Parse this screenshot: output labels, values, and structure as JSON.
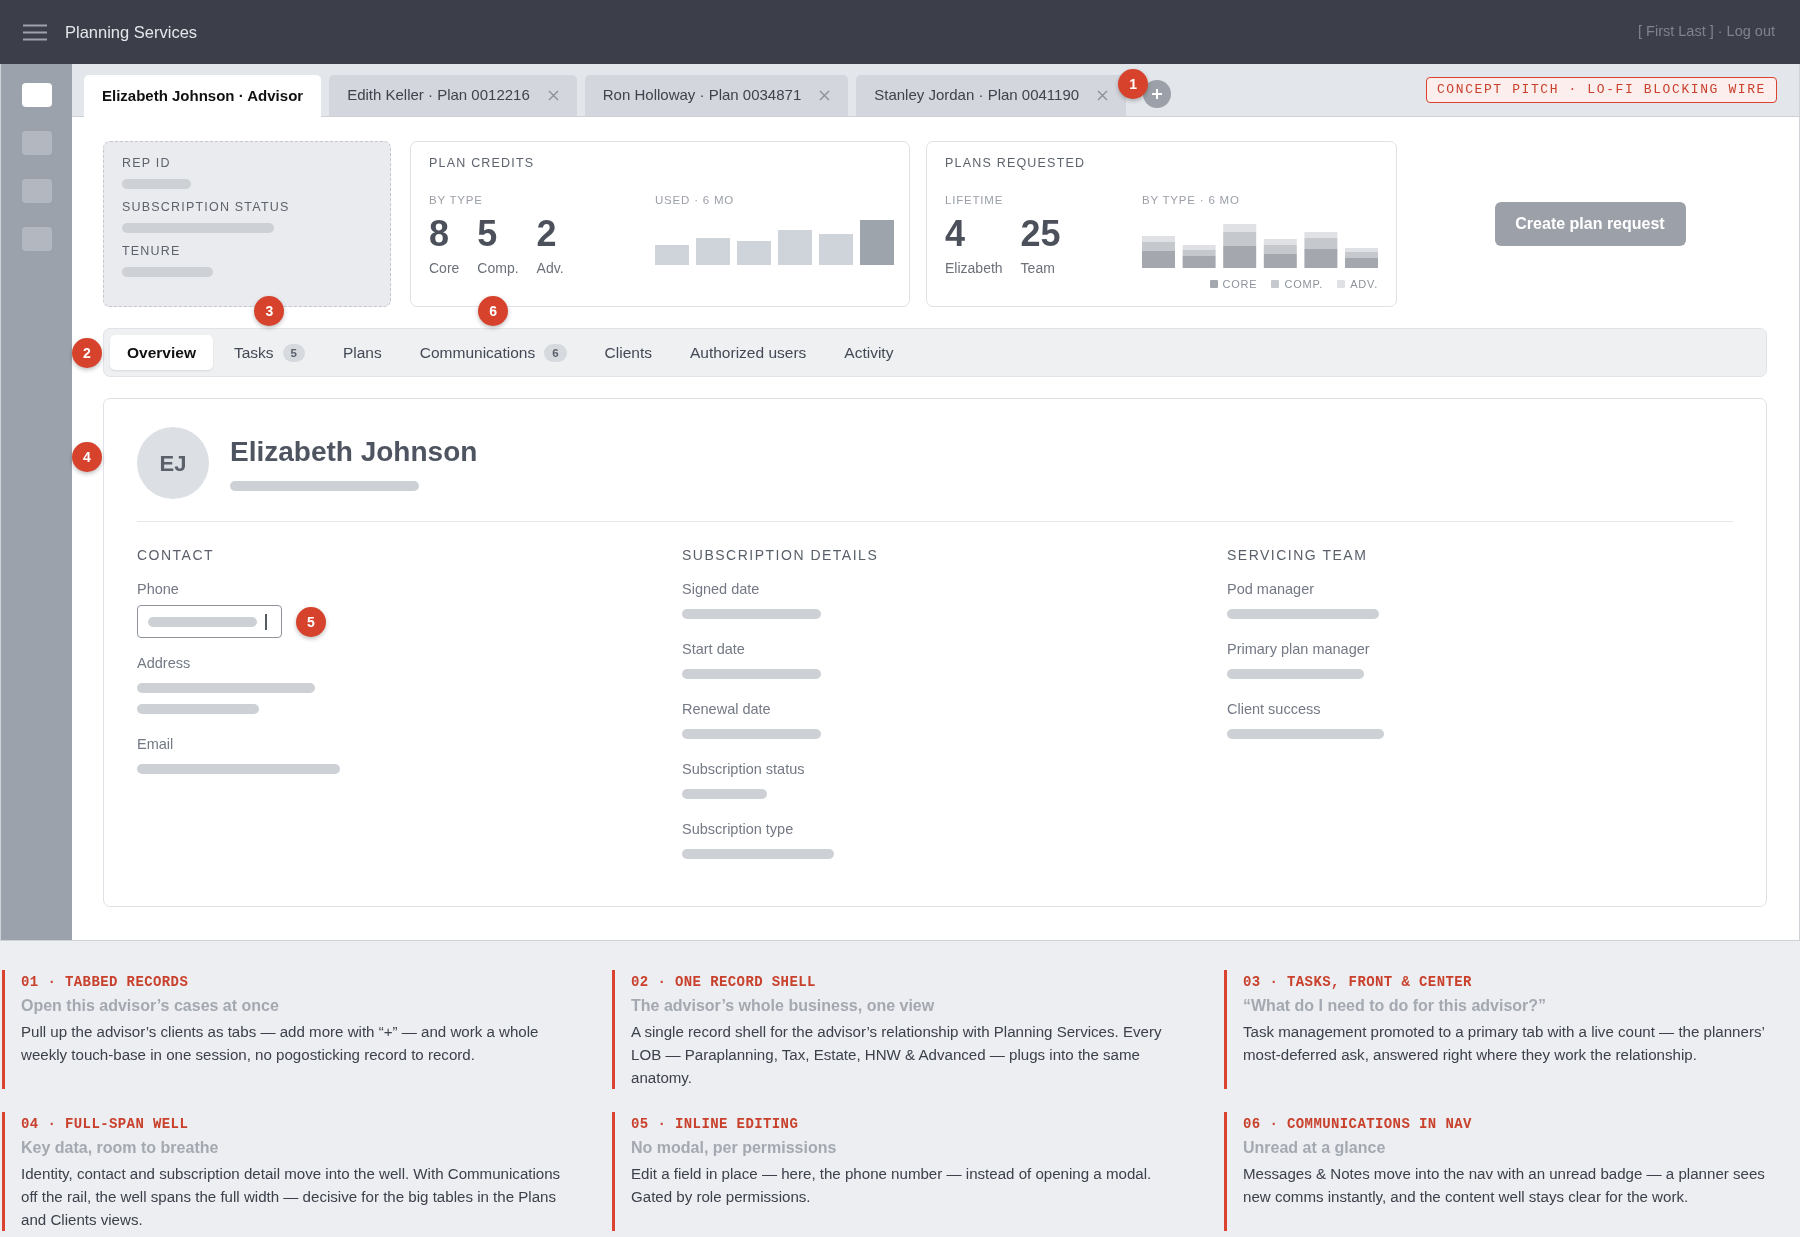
{
  "top_bar": {
    "title": "Planning Services",
    "user": "[ First Last ]",
    "separator": "·",
    "logout": "Log out"
  },
  "rail": {
    "items": [
      {
        "selected": true
      },
      {
        "selected": false
      },
      {
        "selected": false
      },
      {
        "selected": false
      }
    ]
  },
  "record_tabs": {
    "callout": "1",
    "tabs": [
      {
        "label": "Elizabeth Johnson · Advisor",
        "selected": true,
        "closable": false
      },
      {
        "label": "Edith Keller · Plan 0012216",
        "selected": false,
        "closable": true
      },
      {
        "label": "Ron Holloway · Plan 0034871",
        "selected": false,
        "closable": true
      },
      {
        "label": "Stanley Jordan · Plan 0041190",
        "selected": false,
        "closable": true
      }
    ]
  },
  "stamp": "CONCEPT PITCH · LO-FI BLOCKING WIRE",
  "summary": {
    "fields": [
      {
        "label": "REP ID"
      },
      {
        "label": "SUBSCRIPTION STATUS"
      },
      {
        "label": "TENURE"
      }
    ]
  },
  "plan_credits": {
    "title": "PLAN CREDITS",
    "stats_label": "BY TYPE",
    "stats": [
      {
        "value": "8",
        "label": "Core"
      },
      {
        "value": "5",
        "label": "Comp."
      },
      {
        "value": "2",
        "label": "Adv."
      }
    ],
    "chart_label": "USED · 6 MO"
  },
  "plans_requested": {
    "title": "PLANS REQUESTED",
    "stats_label": "LIFETIME",
    "stats": [
      {
        "value": "4",
        "label": "Elizabeth"
      },
      {
        "value": "25",
        "label": "Team"
      }
    ],
    "chart_label": "BY TYPE · 6 MO",
    "legend": [
      {
        "label": "CORE",
        "color": "#a4a8ae"
      },
      {
        "label": "COMP.",
        "color": "#c5c8cd"
      },
      {
        "label": "ADV.",
        "color": "#dfe1e5"
      }
    ]
  },
  "create_button": "Create plan request",
  "section_nav": {
    "callout": "2",
    "items": [
      {
        "label": "Overview",
        "selected": true
      },
      {
        "label": "Tasks",
        "count": "5",
        "callout": "3",
        "selected": false
      },
      {
        "label": "Plans",
        "selected": false
      },
      {
        "label": "Communications",
        "count": "6",
        "callout": "6",
        "selected": false
      },
      {
        "label": "Clients",
        "selected": false
      },
      {
        "label": "Authorized users",
        "selected": false
      },
      {
        "label": "Activity",
        "selected": false
      }
    ]
  },
  "well": {
    "callout": "4",
    "initials": "EJ",
    "name": "Elizabeth Johnson",
    "columns": [
      {
        "heading": "CONTACT",
        "fields": [
          {
            "label": "Phone",
            "kind": "input",
            "callout": "5"
          },
          {
            "label": "Address",
            "kind": "multiline"
          },
          {
            "label": "Email",
            "kind": "line"
          }
        ]
      },
      {
        "heading": "SUBSCRIPTION DETAILS",
        "fields": [
          {
            "label": "Signed date",
            "kind": "line"
          },
          {
            "label": "Start date",
            "kind": "line"
          },
          {
            "label": "Renewal date",
            "kind": "line"
          },
          {
            "label": "Subscription status",
            "kind": "line"
          },
          {
            "label": "Subscription type",
            "kind": "line"
          }
        ]
      },
      {
        "heading": "SERVICING TEAM",
        "fields": [
          {
            "label": "Pod manager",
            "kind": "line"
          },
          {
            "label": "Primary plan manager",
            "kind": "line"
          },
          {
            "label": "Client success",
            "kind": "line"
          }
        ]
      }
    ]
  },
  "notes": [
    {
      "title": "01 · TABBED RECORDS",
      "subtitle": "Open this advisor’s cases at once",
      "body": "Pull up the advisor’s clients as tabs — add more with “+” — and work a whole weekly touch-base in one session, no pogosticking record to record."
    },
    {
      "title": "02 · ONE RECORD SHELL",
      "subtitle": "The advisor’s whole business, one view",
      "body": "A single record shell for the advisor’s relationship with Planning Services. Every LOB — Paraplanning, Tax, Estate, HNW & Advanced — plugs into the same anatomy."
    },
    {
      "title": "03 · TASKS, FRONT & CENTER",
      "subtitle": "“What do I need to do for this advisor?”",
      "body": "Task management promoted to a primary tab with a live count — the planners’ most-deferred ask, answered right where they work the relationship."
    },
    {
      "title": "04 · FULL-SPAN WELL",
      "subtitle": "Key data, room to breathe",
      "body": "Identity, contact and subscription detail move into the well. With Communications off the rail, the well spans the full width — decisive for the big tables in the Plans and Clients views."
    },
    {
      "title": "05 · INLINE EDITING",
      "subtitle": "No modal, per permissions",
      "body": "Edit a field in place — here, the phone number — instead of opening a modal. Gated by role permissions."
    },
    {
      "title": "06 · COMMUNICATIONS IN NAV",
      "subtitle": "Unread at a glance",
      "body": "Messages & Notes move into the nav with an unread badge — a planner sees new comms instantly, and the content well stays clear for the work."
    }
  ]
}
